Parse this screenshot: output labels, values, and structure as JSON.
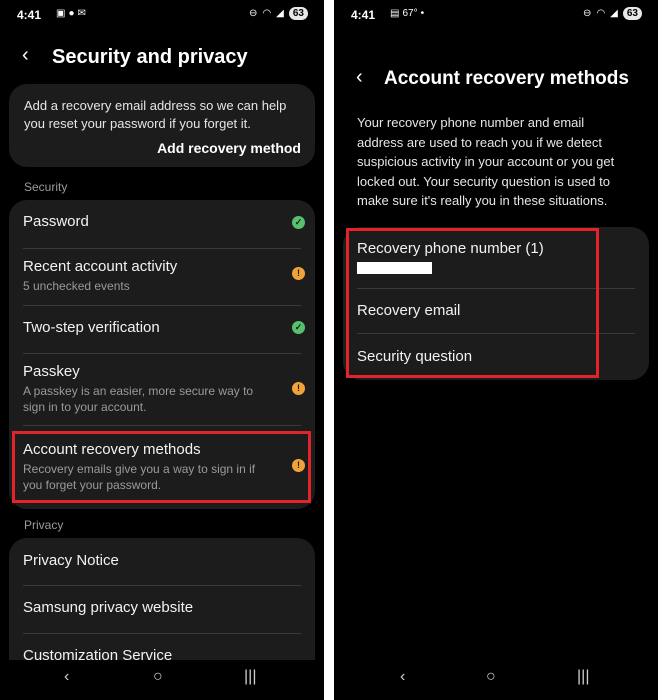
{
  "left": {
    "status": {
      "time": "4:41",
      "battery": "63"
    },
    "title": "Security and privacy",
    "info_card": {
      "text": "Add a recovery email address so we can help you reset your password if you forget it.",
      "action": "Add recovery method"
    },
    "security_label": "Security",
    "security_items": [
      {
        "title": "Password",
        "sub": "",
        "status": "ok"
      },
      {
        "title": "Recent account activity",
        "sub": "5 unchecked events",
        "status": "warn"
      },
      {
        "title": "Two-step verification",
        "sub": "",
        "status": "ok"
      },
      {
        "title": "Passkey",
        "sub": "A passkey is an easier, more secure way to sign in to your account.",
        "status": "warn"
      },
      {
        "title": "Account recovery methods",
        "sub": "Recovery emails give you a way to sign in if you forget your password.",
        "status": "warn"
      }
    ],
    "privacy_label": "Privacy",
    "privacy_items": [
      {
        "title": "Privacy Notice"
      },
      {
        "title": "Samsung privacy website"
      },
      {
        "title": "Customization Service"
      }
    ]
  },
  "right": {
    "status": {
      "time": "4:41",
      "temp": "67°",
      "battery": "63"
    },
    "title": "Account recovery methods",
    "description": "Your recovery phone number and email address are used to reach you if we detect suspicious activity in your account or you get locked out. Your security question is used to make sure it's really you in these situations.",
    "items": [
      {
        "title": "Recovery phone number (1)"
      },
      {
        "title": "Recovery email"
      },
      {
        "title": "Security question"
      }
    ]
  },
  "icons": {
    "ok": "✓",
    "warn": "!"
  },
  "colors": {
    "highlight": "#e0242b",
    "ok": "#56c16d",
    "warn": "#f0a33a"
  }
}
